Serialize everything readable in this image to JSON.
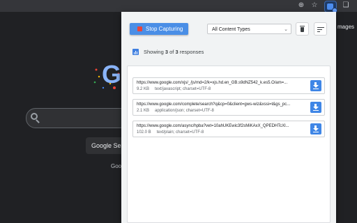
{
  "browser": {
    "zoom_icon": "zoom-icon",
    "bookmark_icon": "star-icon",
    "extension_icon": "network-capture-extension-icon",
    "extensions_icon": "puzzle-icon"
  },
  "google_page": {
    "logo_letter": "G",
    "search_button": "Google Sea",
    "offered_in": "Goog",
    "images_link": "mages"
  },
  "popup": {
    "stop_button_label": "Stop Capturing",
    "content_type_filter": {
      "selected": "All Content Types"
    },
    "status": {
      "prefix": "Showing ",
      "shown": "3",
      "middle": " of ",
      "total": "3",
      "suffix": " responses"
    },
    "responses": [
      {
        "url": "https://www.google.com/xjs/_/js/md=2/k=xjs.hd.en_GB.s9dNZ542_k.es5.O/am=...",
        "size": "9.2 KB",
        "mime": "text/javascript; charset=UTF-8"
      },
      {
        "url": "https://www.google.com/complete/search?q&cp=0&client=gws-wiz&xssi=t&gs_pc...",
        "size": "2.1 KB",
        "mime": "application/json; charset=UTF-8"
      },
      {
        "url": "https://www.google.com/async/hpba?vet=10ahUKEwic3f2sMiKAxX_QPEDHTcXl...",
        "size": "102.0 B",
        "mime": "text/plain; charset=UTF-8"
      }
    ]
  },
  "colors": {
    "accent": "#4a8ee6",
    "stop_square": "#e8453c",
    "page_bg": "#202124"
  }
}
